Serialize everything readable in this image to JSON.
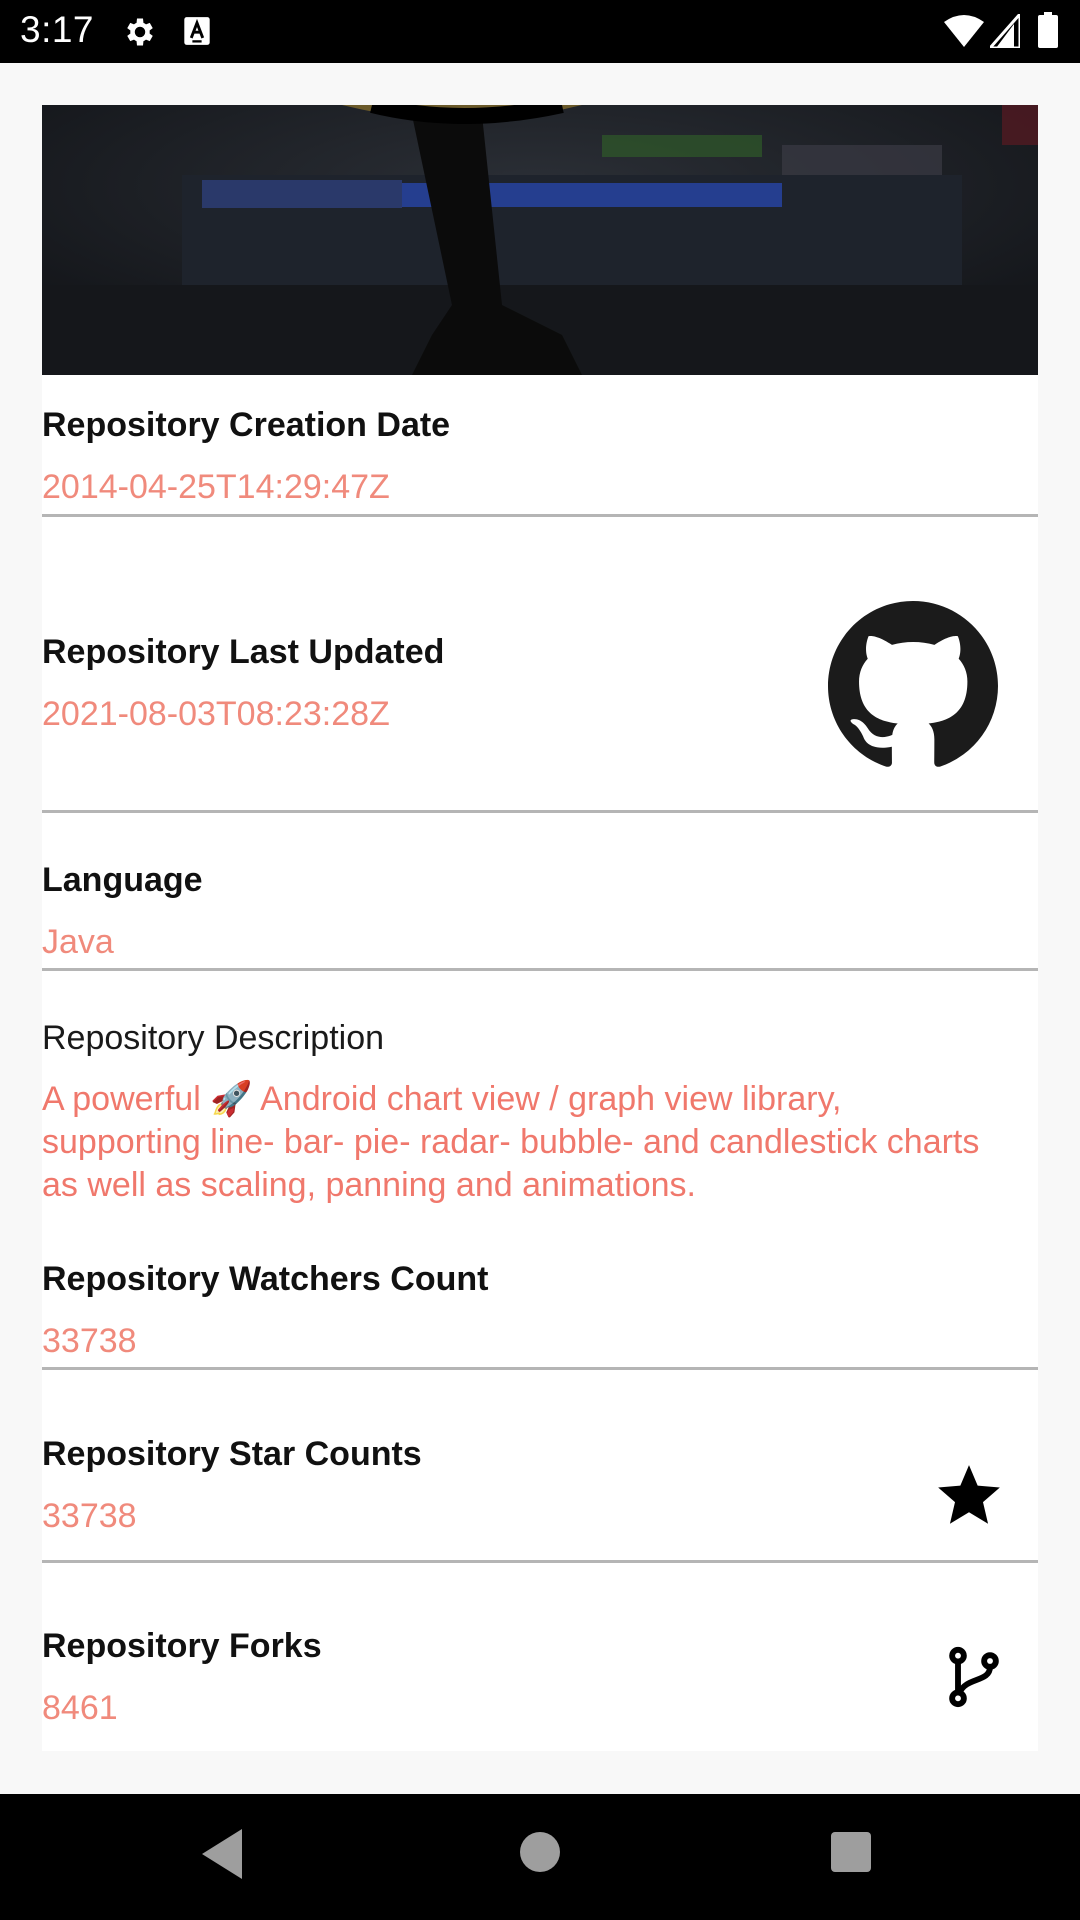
{
  "status_bar": {
    "time": "3:17",
    "icons": [
      "gear-icon",
      "text-a-icon",
      "wifi-icon",
      "signal-icon",
      "battery-icon"
    ]
  },
  "repository": {
    "creation_date": {
      "label": "Repository Creation Date",
      "value": "2014-04-25T14:29:47Z"
    },
    "last_updated": {
      "label": "Repository Last Updated",
      "value": "2021-08-03T08:23:28Z",
      "icon": "github-octocat-icon"
    },
    "language": {
      "label": "Language",
      "value": "Java"
    },
    "description": {
      "label": "Repository Description",
      "value": "A powerful 🚀 Android chart view / graph view library, supporting line- bar- pie- radar- bubble- and candlestick charts as well as scaling, panning and animations."
    },
    "watchers": {
      "label": "Repository Watchers Count",
      "value": "33738"
    },
    "stars": {
      "label": "Repository Star Counts",
      "value": "33738",
      "icon": "star-icon"
    },
    "forks": {
      "label": "Repository Forks",
      "value": "8461",
      "icon": "fork-icon"
    }
  },
  "nav_bar": {
    "icons": [
      "back-icon",
      "home-icon",
      "recents-icon"
    ]
  },
  "colors": {
    "value_text": "#f08a7c",
    "label_text": "#111111",
    "divider": "#b5b5b5",
    "background": "#f8f8f8"
  }
}
